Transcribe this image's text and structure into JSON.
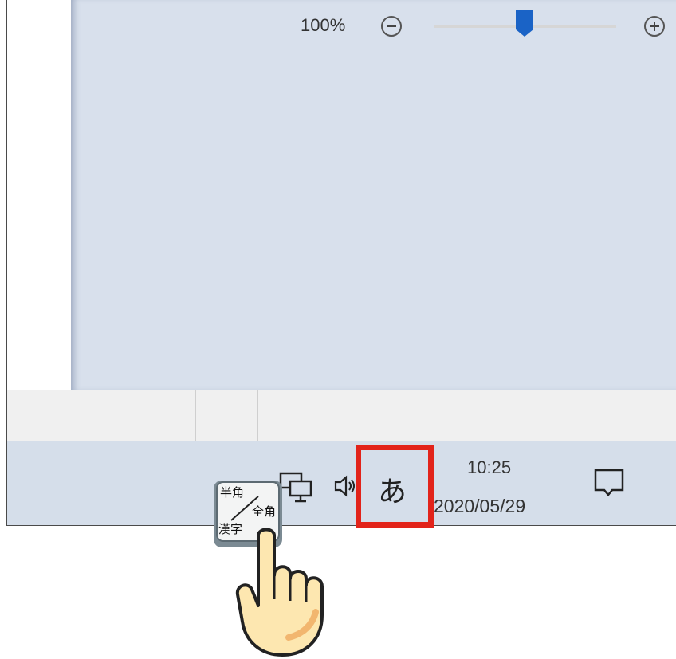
{
  "statusbar": {
    "zoom_percent": "100%",
    "zoom_level": 0.5
  },
  "taskbar": {
    "ime_mode": "あ",
    "time": "10:25",
    "date": "2020/05/29",
    "icons": [
      "network-icon",
      "volume-icon",
      "notification-icon"
    ]
  },
  "key": {
    "top_left": "半角",
    "right": "全角",
    "bottom_left": "漢字"
  },
  "colors": {
    "highlight": "#e2231a",
    "slider_thumb": "#1a63c6",
    "taskbar": "#d5deea"
  }
}
